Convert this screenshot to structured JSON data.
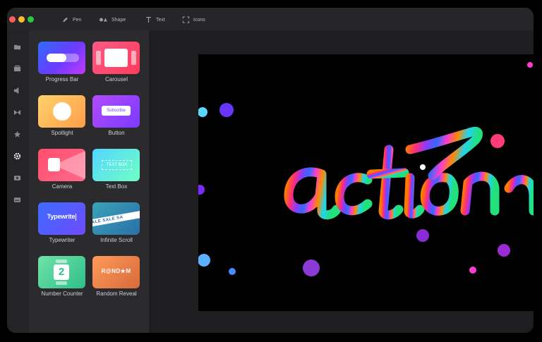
{
  "toolbar": {
    "pen": "Pen",
    "shape": "Shape",
    "text": "Text",
    "icons": "Icons"
  },
  "rail": {
    "icons": [
      "folder-icon",
      "media-icon",
      "audio-icon",
      "transitions-icon",
      "effects-star-icon",
      "components-gear-icon",
      "record-icon",
      "subtitles-icon"
    ],
    "active": "components-gear-icon"
  },
  "components": [
    {
      "label": "Progress Bar"
    },
    {
      "label": "Carousel"
    },
    {
      "label": "Spotlight"
    },
    {
      "label": "Button",
      "preview_text": "Subscribe"
    },
    {
      "label": "Camera"
    },
    {
      "label": "Text Box",
      "preview_text": "TEXT BOX"
    },
    {
      "label": "Typewriter",
      "preview_text": "Typewrite"
    },
    {
      "label": "Infinite Scroll",
      "preview_text": "SALE SALE SA"
    },
    {
      "label": "Number Counter",
      "preview_text": "2"
    },
    {
      "label": "Random Reveal",
      "preview_text": "R@ND★M"
    }
  ],
  "canvas": {
    "text": "action"
  },
  "colors": {
    "close": "#ff5f57",
    "minimize": "#febc2e",
    "maximize": "#28c840"
  }
}
